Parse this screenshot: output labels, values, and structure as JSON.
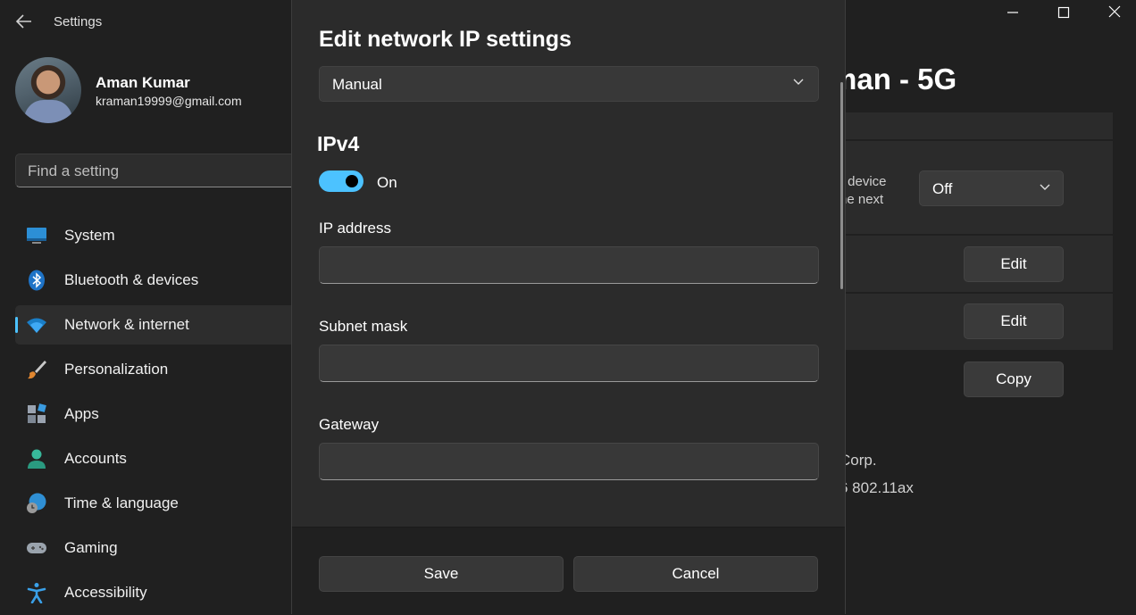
{
  "app": {
    "title": "Settings"
  },
  "user": {
    "name": "Aman Kumar",
    "email": "kraman19999@gmail.com"
  },
  "search": {
    "placeholder": "Find a setting"
  },
  "nav": {
    "items": [
      {
        "label": "System",
        "icon": "monitor-icon",
        "active": false
      },
      {
        "label": "Bluetooth & devices",
        "icon": "bluetooth-icon",
        "active": false
      },
      {
        "label": "Network & internet",
        "icon": "wifi-icon",
        "active": true
      },
      {
        "label": "Personalization",
        "icon": "brush-icon",
        "active": false
      },
      {
        "label": "Apps",
        "icon": "apps-icon",
        "active": false
      },
      {
        "label": "Accounts",
        "icon": "person-icon",
        "active": false
      },
      {
        "label": "Time & language",
        "icon": "globe-clock-icon",
        "active": false
      },
      {
        "label": "Gaming",
        "icon": "gamepad-icon",
        "active": false
      },
      {
        "label": "Accessibility",
        "icon": "accessibility-icon",
        "active": false
      }
    ]
  },
  "background": {
    "page_title_fragment": "man - 5G",
    "random_hw": {
      "text_line1": "r device",
      "text_line2": "he next",
      "dropdown_value": "Off"
    },
    "buttons": {
      "edit1": "Edit",
      "edit2": "Edit",
      "copy": "Copy"
    },
    "properties": {
      "manufacturer_fragment": "Corp.",
      "description_fragment": "6 802.11ax"
    }
  },
  "dialog": {
    "title": "Edit network IP settings",
    "mode_select": {
      "value": "Manual"
    },
    "section": "IPv4",
    "toggle": {
      "state_label": "On",
      "on": true
    },
    "fields": [
      {
        "label": "IP address",
        "value": ""
      },
      {
        "label": "Subnet mask",
        "value": ""
      },
      {
        "label": "Gateway",
        "value": ""
      }
    ],
    "save_label": "Save",
    "cancel_label": "Cancel"
  },
  "colors": {
    "accent": "#4cc2ff",
    "window_bg": "#202020",
    "dialog_bg": "#2b2b2b"
  }
}
